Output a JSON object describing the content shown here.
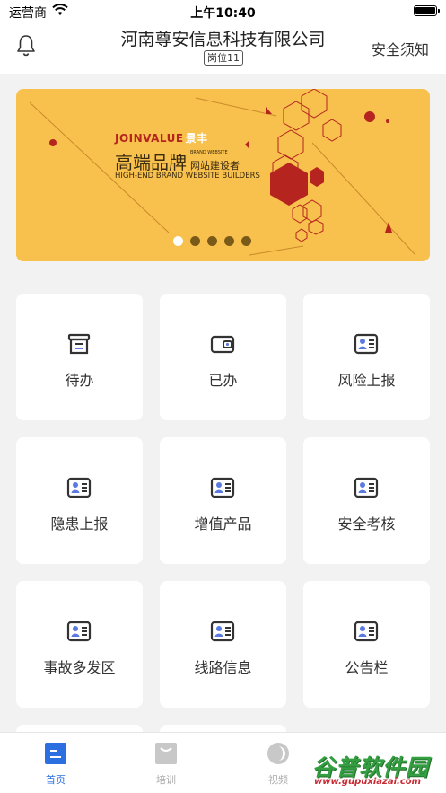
{
  "status_bar": {
    "carrier": "运营商",
    "time": "上午10:40"
  },
  "nav": {
    "title": "河南尊安信息科技有限公司",
    "post_badge": "岗位11",
    "notice_label": "安全须知",
    "bell_icon": "bell-icon"
  },
  "banner": {
    "brand_en": "JOINVALUE",
    "brand_cn": "景丰",
    "headline": "高端品牌",
    "sub_small": "BRAND WEBSITE",
    "sub_cn": "网站建设者",
    "tagline_en": "HIGH-END BRAND WEBSITE BUILDERS",
    "slides": 5,
    "active_slide": 0,
    "colors": {
      "background": "#f8c04c",
      "accent": "#b5241f"
    }
  },
  "grid": {
    "items": [
      {
        "label": "待办",
        "icon": "inbox-icon"
      },
      {
        "label": "已办",
        "icon": "wallet-icon"
      },
      {
        "label": "风险上报",
        "icon": "id-card-icon"
      },
      {
        "label": "隐患上报",
        "icon": "id-card-icon"
      },
      {
        "label": "增值产品",
        "icon": "id-card-icon"
      },
      {
        "label": "安全考核",
        "icon": "id-card-icon"
      },
      {
        "label": "事故多发区",
        "icon": "id-card-icon"
      },
      {
        "label": "线路信息",
        "icon": "id-card-icon"
      },
      {
        "label": "公告栏",
        "icon": "id-card-icon"
      }
    ]
  },
  "tabbar": {
    "tabs": [
      {
        "label": "首页",
        "icon": "home-icon",
        "active": true
      },
      {
        "label": "培训",
        "icon": "training-icon",
        "active": false
      },
      {
        "label": "视频",
        "icon": "video-icon",
        "active": false
      }
    ],
    "colors": {
      "active": "#2c6fe0",
      "inactive": "#aaaaaa"
    }
  },
  "watermark": {
    "text_cn": "谷普软件园",
    "url": "www.gupuxiazai.com"
  }
}
